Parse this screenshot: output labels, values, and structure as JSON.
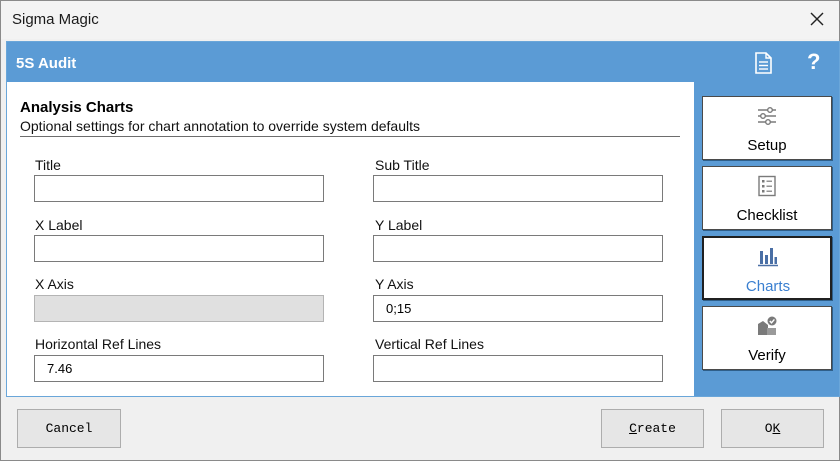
{
  "window": {
    "title": "Sigma Magic"
  },
  "header": {
    "title": "5S Audit"
  },
  "section": {
    "title": "Analysis Charts",
    "subtitle": "Optional settings for chart annotation to override system defaults"
  },
  "fields": {
    "title": {
      "label": "Title",
      "value": ""
    },
    "sub_title": {
      "label": "Sub Title",
      "value": ""
    },
    "x_label": {
      "label": "X Label",
      "value": ""
    },
    "y_label": {
      "label": "Y Label",
      "value": ""
    },
    "x_axis": {
      "label": "X Axis",
      "value": ""
    },
    "y_axis": {
      "label": "Y Axis",
      "value": "0;15"
    },
    "h_ref_lines": {
      "label": "Horizontal Ref Lines",
      "value": "7.46"
    },
    "v_ref_lines": {
      "label": "Vertical Ref Lines",
      "value": ""
    }
  },
  "nav": [
    {
      "label": "Setup",
      "icon": "sliders-icon",
      "active": false
    },
    {
      "label": "Checklist",
      "icon": "checklist-icon",
      "active": false
    },
    {
      "label": "Charts",
      "icon": "bar-chart-icon",
      "active": true
    },
    {
      "label": "Verify",
      "icon": "verify-icon",
      "active": false
    }
  ],
  "buttons": {
    "cancel": "Cancel",
    "create_first": "C",
    "create_rest": "reate",
    "ok_first": "O",
    "ok_rest": "K"
  },
  "colors": {
    "accent": "#5b9bd5",
    "active_text": "#3a7fd0"
  }
}
